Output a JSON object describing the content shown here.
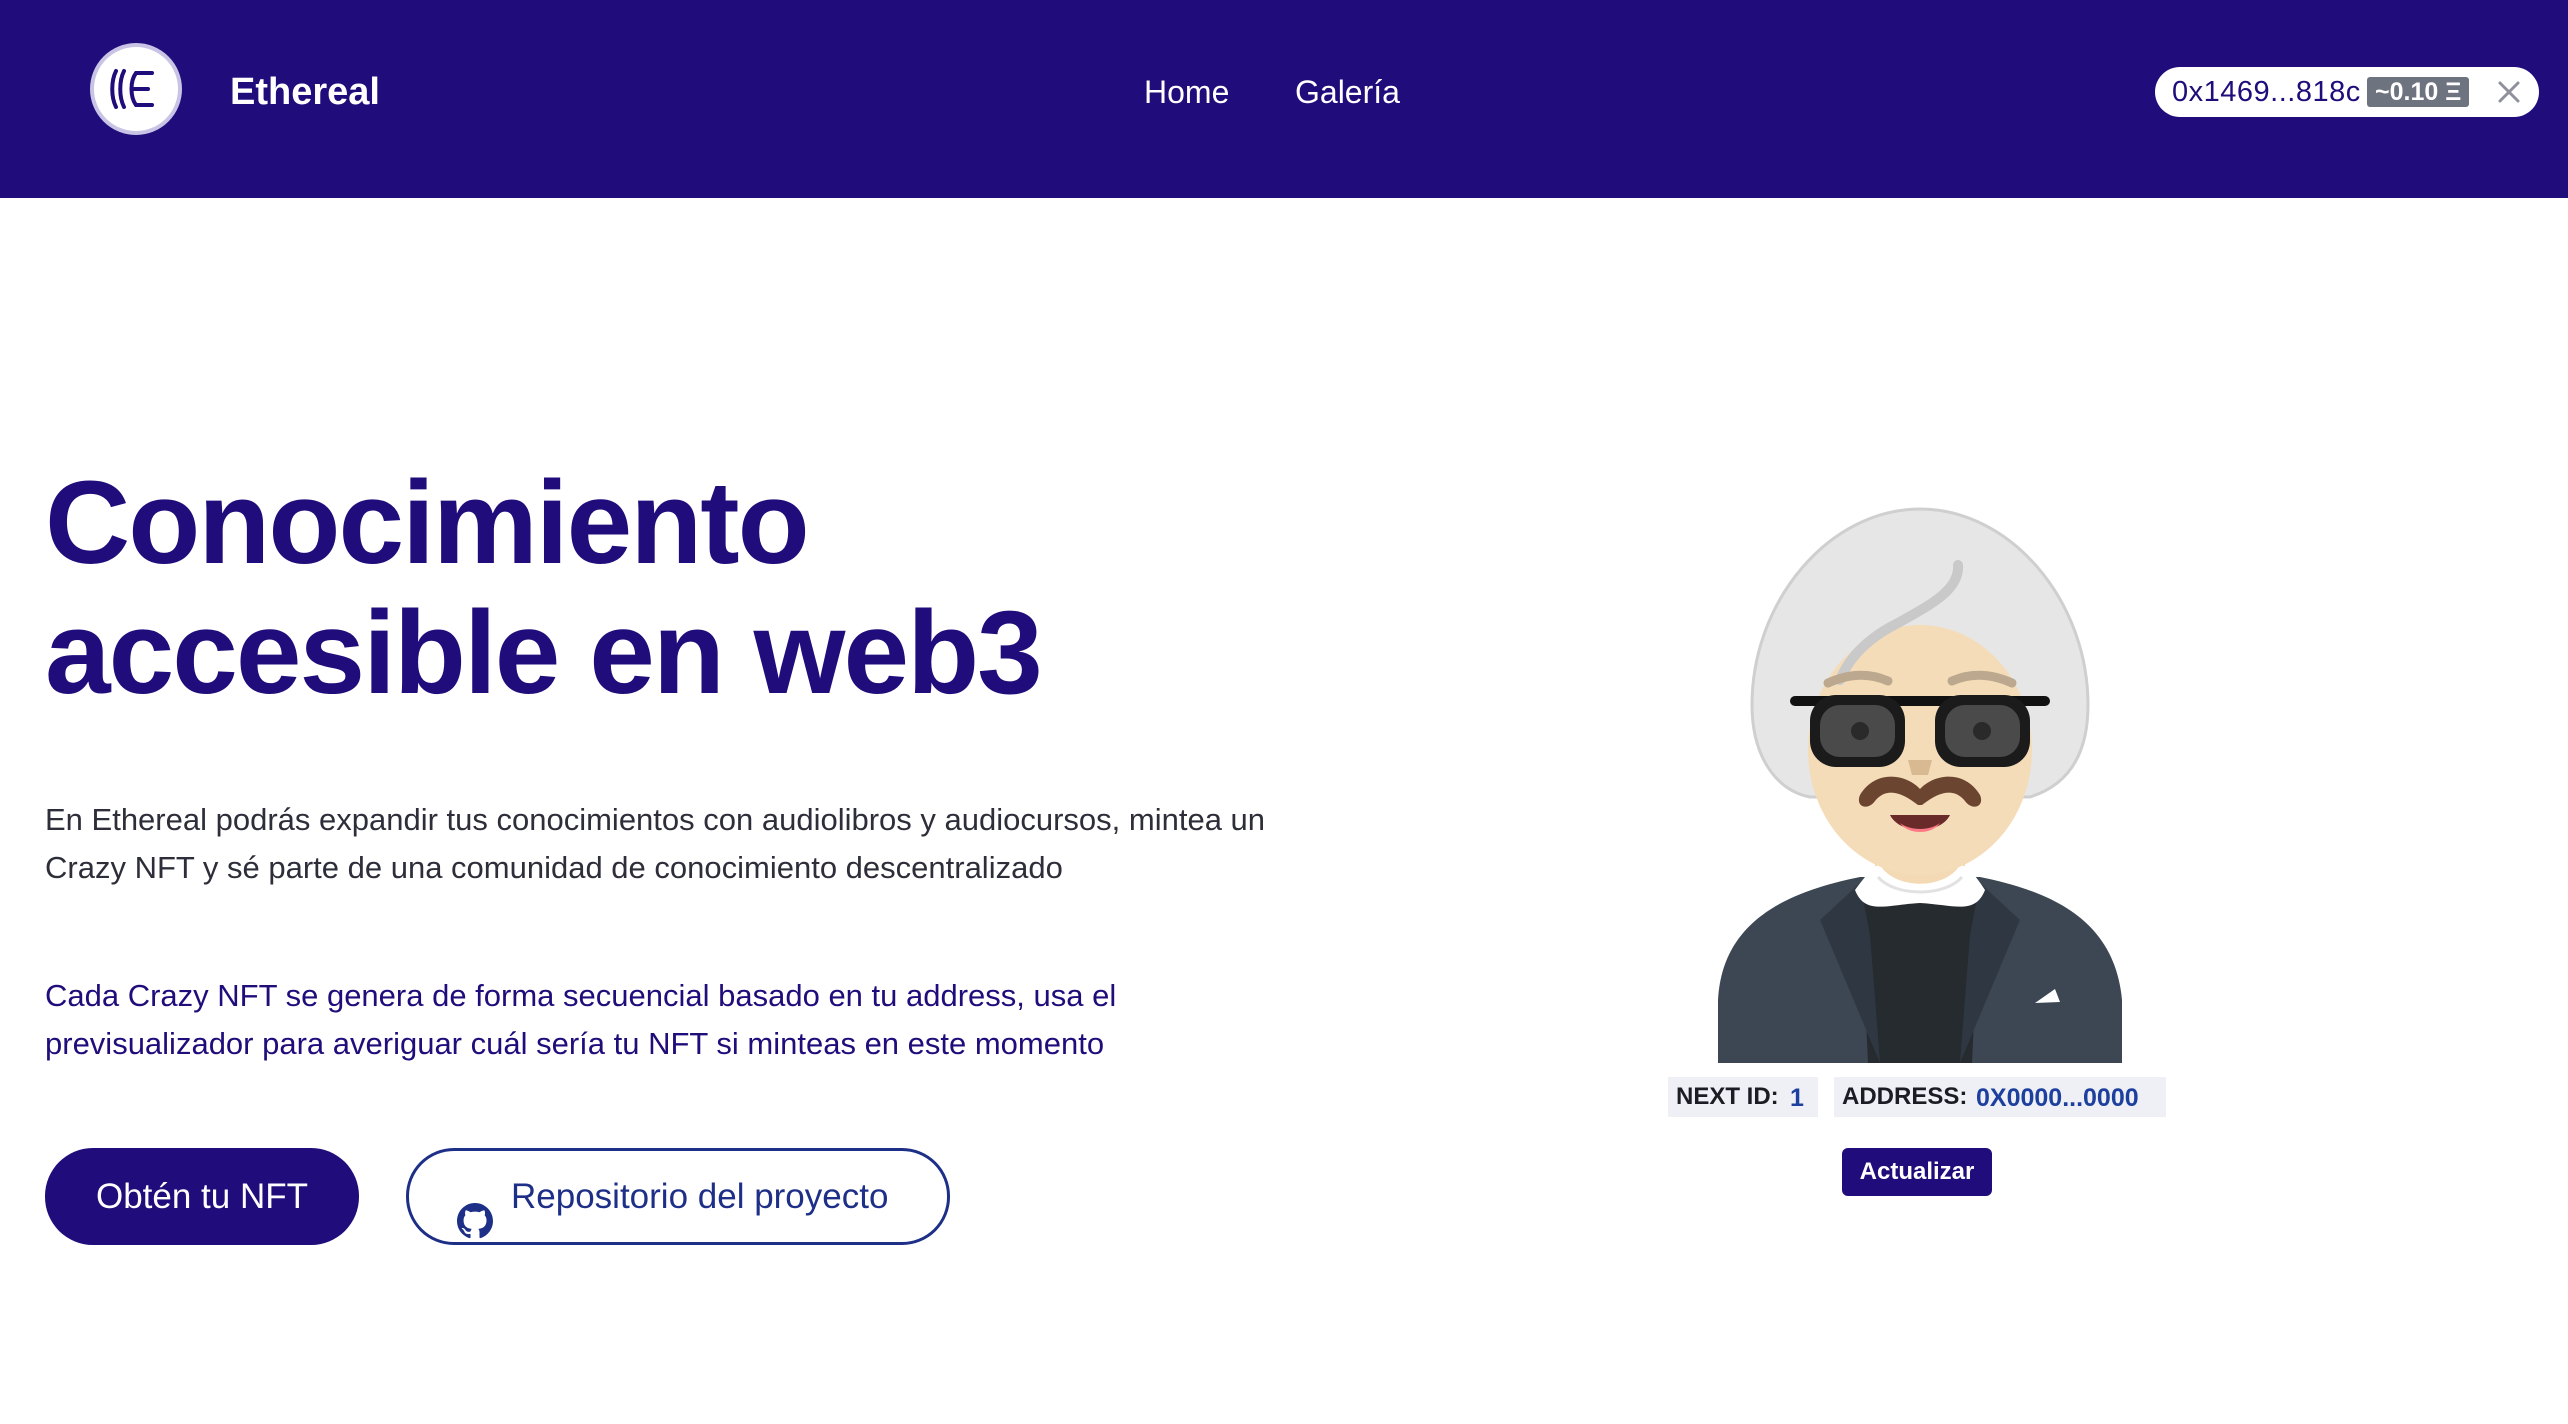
{
  "header": {
    "brand": "Ethereal",
    "nav": [
      {
        "label": "Home"
      },
      {
        "label": "Galería"
      }
    ],
    "wallet": {
      "address": "0x1469...818c",
      "balance": "~0.10 Ξ"
    }
  },
  "hero": {
    "title_line1": "Conocimiento",
    "title_line2": "accesible en web3",
    "description": "En Ethereal podrás expandir tus conocimientos con audiolibros y audiocursos, mintea un Crazy NFT y sé parte de una comunidad de conocimiento descentralizado",
    "note": "Cada Crazy NFT se genera de forma secuencial basado en tu address, usa el previsualizador para averiguar cuál sería tu NFT si minteas en este momento",
    "primary_button": "Obtén tu NFT",
    "secondary_button": "Repositorio del proyecto"
  },
  "preview": {
    "next_id_label": "NEXT ID:",
    "next_id_value": "1",
    "address_label": "ADDRESS:",
    "address_value": "0X0000...0000",
    "update_button": "Actualizar"
  },
  "colors": {
    "brand": "#200c7b",
    "link_blue": "#1d2f87"
  },
  "icons": [
    "ethereal-logo-icon",
    "close-icon",
    "github-icon"
  ]
}
